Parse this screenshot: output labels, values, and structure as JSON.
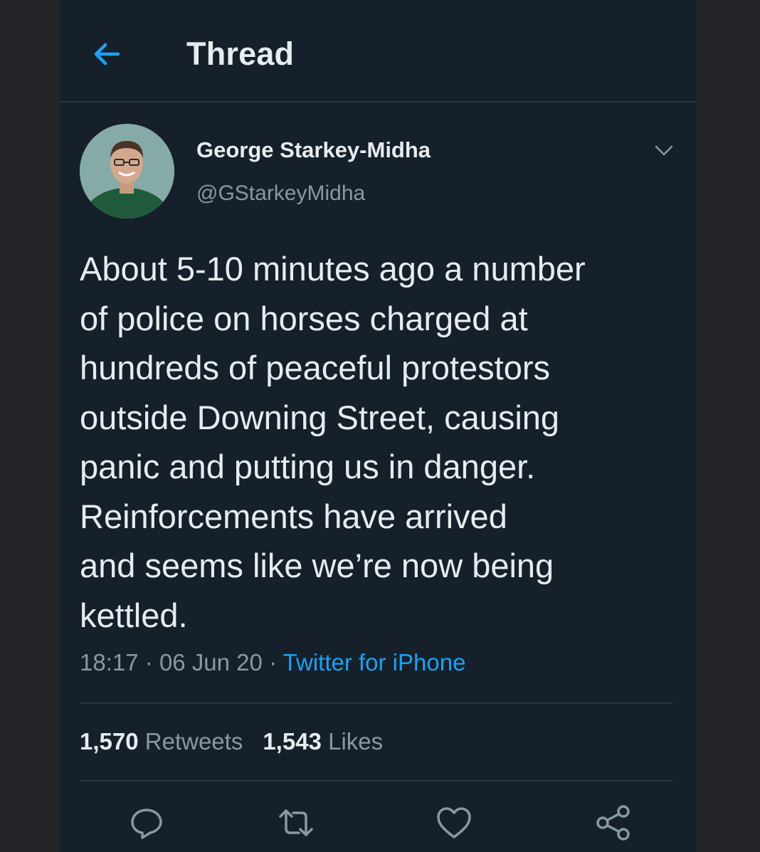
{
  "header": {
    "back_icon": "arrow-left-icon",
    "title": "Thread"
  },
  "tweet": {
    "author": {
      "display_name": "George Starkey-Midha",
      "handle": "@GStarkeyMidha"
    },
    "text": "About 5-10 minutes ago a number\nof police on horses charged at\nhundreds of peaceful protestors\noutside Downing Street, causing\npanic and putting us in danger.\nReinforcements have arrived\nand seems like we’re now being\nkettled.",
    "time": "18:17",
    "date": "06 Jun 20",
    "separator": "·",
    "source": "Twitter for iPhone",
    "stats": {
      "retweets_count": "1,570",
      "retweets_label": "Retweets",
      "likes_count": "1,543",
      "likes_label": "Likes"
    },
    "actions": [
      "reply-icon",
      "retweet-icon",
      "like-icon",
      "share-icon"
    ]
  },
  "colors": {
    "background": "#15202b",
    "text": "#e8ecef",
    "secondary_text": "#8899a6",
    "accent": "#1da1f2",
    "divider": "#283645"
  }
}
